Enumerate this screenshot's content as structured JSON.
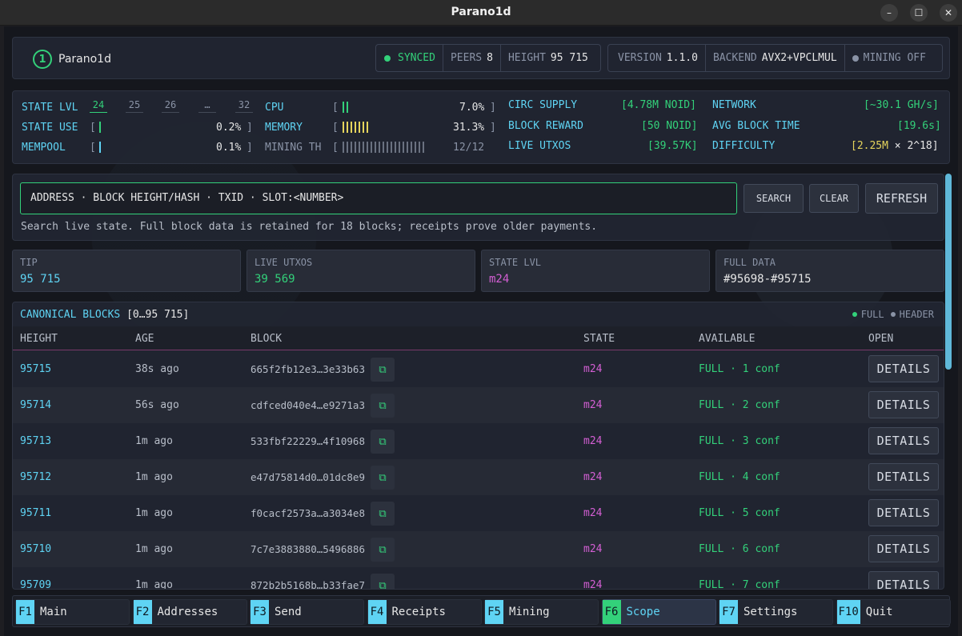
{
  "window": {
    "title": "Parano1d",
    "minimize": "–",
    "maximize": "☐",
    "close": "✕"
  },
  "header": {
    "logo_glyph": "1",
    "brand": "Parano1d",
    "status": {
      "synced": "SYNCED",
      "peers_label": "PEERS",
      "peers": "8",
      "height_label": "HEIGHT",
      "height": "95 715"
    },
    "info": {
      "version_label": "VERSION",
      "version": "1.1.0",
      "backend_label": "BACKEND",
      "backend": "AVX2+VPCLMUL",
      "mining": "MINING OFF"
    }
  },
  "stats": {
    "state_lvl_label": "STATE LVL",
    "levels": [
      "24",
      "25",
      "26",
      "…",
      "32"
    ],
    "state_use_label": "STATE USE",
    "state_use": "0.2%",
    "state_use_fraction": 0.002,
    "mempool_label": "MEMPOOL",
    "mempool": "0.1%",
    "mempool_fraction": 0.001,
    "cpu_label": "CPU",
    "cpu": "7.0%",
    "cpu_fraction": 0.07,
    "memory_label": "MEMORY",
    "memory": "31.3%",
    "memory_fraction": 0.313,
    "mining_th_label": "MINING TH",
    "mining_th": "12/12",
    "circ_supply_label": "CIRC SUPPLY",
    "circ_supply": "[4.78M NOID]",
    "block_reward_label": "BLOCK REWARD",
    "block_reward": "[50 NOID]",
    "live_utxos_label": "LIVE UTXOS",
    "live_utxos": "[39.57K]",
    "network_label": "NETWORK",
    "network": "[~30.1 GH/s]",
    "avg_block_time_label": "AVG BLOCK TIME",
    "avg_block_time": "[19.6s]",
    "difficulty_label": "DIFFICULTY",
    "difficulty_open": "[",
    "difficulty_value": "2.25M",
    "difficulty_rest": " × 2^18]"
  },
  "search": {
    "placeholder": "ADDRESS · BLOCK HEIGHT/HASH · TXID · SLOT:<NUMBER>",
    "search_label": "SEARCH",
    "clear_label": "CLEAR",
    "refresh_label": "REFRESH",
    "hint": "Search live state. Full block data is retained for 18 blocks; receipts prove older payments."
  },
  "tiles": {
    "tip_label": "TIP",
    "tip": "95 715",
    "utxos_label": "LIVE UTXOS",
    "utxos": "39 569",
    "state_label": "STATE LVL",
    "state": "m24",
    "full_label": "FULL DATA",
    "full": "#95698-#95715"
  },
  "blocks": {
    "title": "CANONICAL BLOCKS",
    "range": "[0…95 715]",
    "legend_full": "FULL",
    "legend_header": "HEADER",
    "columns": {
      "height": "HEIGHT",
      "age": "AGE",
      "block": "BLOCK",
      "state": "STATE",
      "available": "AVAILABLE",
      "open": "OPEN"
    },
    "copy_glyph": "⧉",
    "details_label": "DETAILS",
    "rows": [
      {
        "height": "95715",
        "age": "38s ago",
        "hash": "665f2fb12e3…3e33b63",
        "state": "m24",
        "available": "FULL · 1 conf"
      },
      {
        "height": "95714",
        "age": "56s ago",
        "hash": "cdfced040e4…e9271a3",
        "state": "m24",
        "available": "FULL · 2 conf"
      },
      {
        "height": "95713",
        "age": "1m ago",
        "hash": "533fbf22229…4f10968",
        "state": "m24",
        "available": "FULL · 3 conf"
      },
      {
        "height": "95712",
        "age": "1m ago",
        "hash": "e47d75814d0…01dc8e9",
        "state": "m24",
        "available": "FULL · 4 conf"
      },
      {
        "height": "95711",
        "age": "1m ago",
        "hash": "f0cacf2573a…a3034e8",
        "state": "m24",
        "available": "FULL · 5 conf"
      },
      {
        "height": "95710",
        "age": "1m ago",
        "hash": "7c7e3883880…5496886",
        "state": "m24",
        "available": "FULL · 6 conf"
      },
      {
        "height": "95709",
        "age": "1m ago",
        "hash": "872b2b5168b…b33fae7",
        "state": "m24",
        "available": "FULL · 7 conf"
      }
    ]
  },
  "fkeys": [
    {
      "key": "F1",
      "label": "Main"
    },
    {
      "key": "F2",
      "label": "Addresses"
    },
    {
      "key": "F3",
      "label": "Send"
    },
    {
      "key": "F4",
      "label": "Receipts"
    },
    {
      "key": "F5",
      "label": "Mining"
    },
    {
      "key": "F6",
      "label": "Scope",
      "active": true
    },
    {
      "key": "F7",
      "label": "Settings"
    },
    {
      "key": "F10",
      "label": "Quit"
    }
  ],
  "colors": {
    "accent_green": "#33d17a",
    "accent_cyan": "#5fd4f4",
    "state_magenta": "#d45fd4",
    "gold": "#e5d45c",
    "background": "#15171d"
  }
}
